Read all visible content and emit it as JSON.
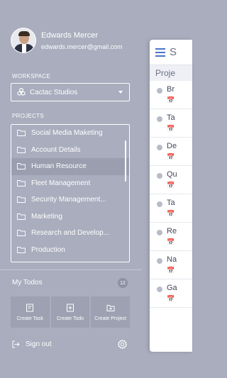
{
  "profile": {
    "name": "Edwards Mercer",
    "email": "edwards.mercer@gmail.com"
  },
  "workspace": {
    "label": "WORKSPACE",
    "selected": "Cactac Studios"
  },
  "projects": {
    "label": "PROJECTS",
    "items": [
      "Social Media Maketing",
      "Account Details",
      "Human Resource",
      "Fleet Management",
      "Security Management...",
      "Marketing",
      "Research and Develop...",
      "Production"
    ],
    "active_index": 2
  },
  "todos": {
    "label": "My Todos",
    "count": "12"
  },
  "actions": [
    {
      "label": "Create Task",
      "icon": "create-task-icon"
    },
    {
      "label": "Create Todo",
      "icon": "create-todo-icon"
    },
    {
      "label": "Create Project",
      "icon": "create-project-icon"
    }
  ],
  "footer": {
    "signout": "Sign out",
    "settings_icon": "gear-icon"
  },
  "background_panel": {
    "title": "S",
    "subheader": "Proje",
    "rows": [
      "Br",
      "Ta",
      "De",
      "Qu",
      "Ta",
      "Re",
      "Na",
      "Ga"
    ]
  },
  "colors": {
    "drawer_bg": "#a9adbd",
    "active_item": "#9a9eae",
    "accent": "#4a74c9"
  }
}
